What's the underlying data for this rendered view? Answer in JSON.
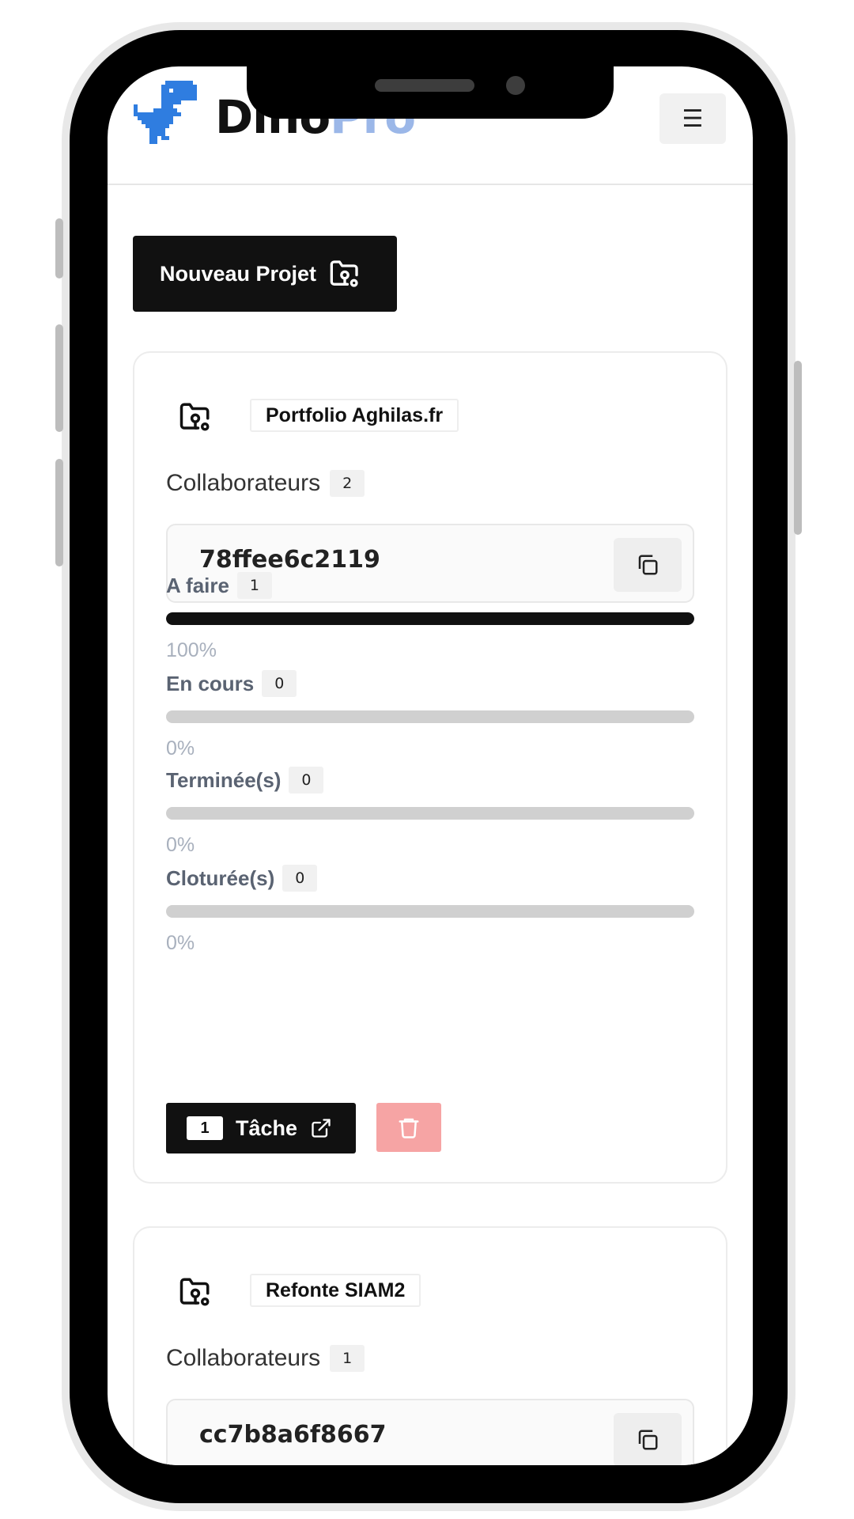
{
  "header": {
    "brand_part1": "Dino",
    "brand_part2": "Pro",
    "menu_icon": "☰"
  },
  "actions": {
    "new_project_label": "Nouveau Projet"
  },
  "projects": [
    {
      "name": "Portfolio Aghilas.fr",
      "collaborators_label": "Collaborateurs",
      "collaborators_count": "2",
      "code": "78ffee6c2119",
      "statuses": [
        {
          "label": "A faire",
          "count": "1",
          "percent_text": "100%",
          "percent": 100
        },
        {
          "label": "En cours",
          "count": "0",
          "percent_text": "0%",
          "percent": 0
        },
        {
          "label": "Terminée(s)",
          "count": "0",
          "percent_text": "0%",
          "percent": 0
        },
        {
          "label": "Cloturée(s)",
          "count": "0",
          "percent_text": "0%",
          "percent": 0
        }
      ],
      "task_count": "1",
      "task_label": "Tâche"
    },
    {
      "name": "Refonte SIAM2",
      "collaborators_label": "Collaborateurs",
      "collaborators_count": "1",
      "code": "cc7b8a6f8667"
    }
  ],
  "icons": {
    "logo": "dino-logo-icon",
    "project": "folder-key-icon",
    "copy": "copy-icon",
    "external": "external-link-icon",
    "delete": "trash-icon"
  },
  "colors": {
    "primary": "#111111",
    "brand_accent": "#9bb7e8",
    "danger_light": "#f6a4a4",
    "progress_track": "#d0d0d0",
    "muted_text": "#a8b0bd"
  }
}
